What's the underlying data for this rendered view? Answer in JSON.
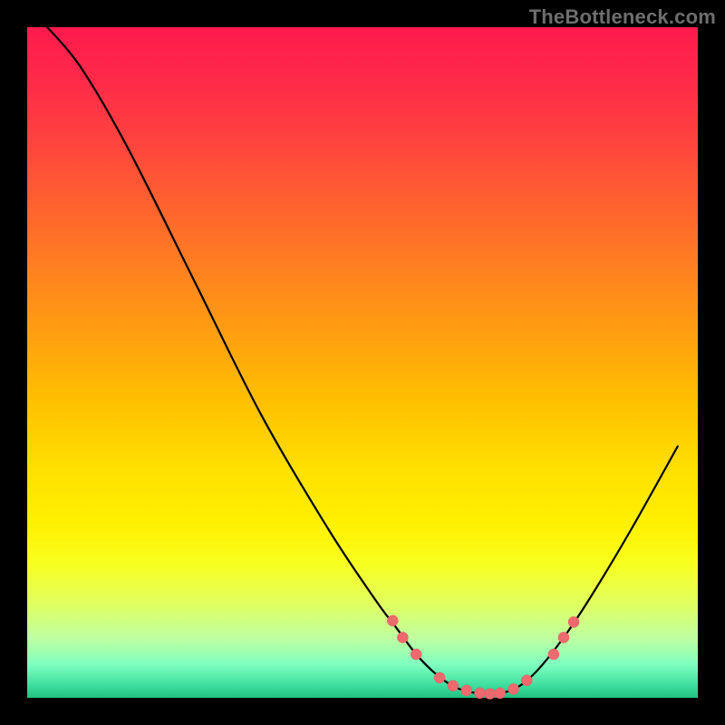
{
  "watermark": "TheBottleneck.com",
  "colors": {
    "frame": "#000000",
    "curve": "#000000",
    "marker_fill": "#ef6a6f",
    "marker_stroke": "#e85a60"
  },
  "chart_data": {
    "type": "line",
    "title": "",
    "xlabel": "",
    "ylabel": "",
    "xlim": [
      0,
      100
    ],
    "ylim": [
      0,
      100
    ],
    "grid": false,
    "curve_points": [
      {
        "x": 3.0,
        "y": 100.0
      },
      {
        "x": 8.0,
        "y": 94.0
      },
      {
        "x": 15.0,
        "y": 82.0
      },
      {
        "x": 25.0,
        "y": 62.0
      },
      {
        "x": 35.0,
        "y": 42.0
      },
      {
        "x": 45.0,
        "y": 25.0
      },
      {
        "x": 52.0,
        "y": 14.5
      },
      {
        "x": 55.0,
        "y": 10.5
      },
      {
        "x": 58.0,
        "y": 6.5
      },
      {
        "x": 61.0,
        "y": 3.5
      },
      {
        "x": 64.0,
        "y": 1.5
      },
      {
        "x": 67.0,
        "y": 0.7
      },
      {
        "x": 70.0,
        "y": 0.6
      },
      {
        "x": 73.0,
        "y": 1.5
      },
      {
        "x": 76.0,
        "y": 4.0
      },
      {
        "x": 80.0,
        "y": 9.0
      },
      {
        "x": 84.0,
        "y": 15.0
      },
      {
        "x": 90.0,
        "y": 25.0
      },
      {
        "x": 97.0,
        "y": 37.5
      }
    ],
    "markers": [
      {
        "x": 54.5,
        "y": 11.5
      },
      {
        "x": 56.0,
        "y": 9.0
      },
      {
        "x": 58.0,
        "y": 6.5
      },
      {
        "x": 61.5,
        "y": 3.0
      },
      {
        "x": 63.5,
        "y": 1.8
      },
      {
        "x": 65.5,
        "y": 1.1
      },
      {
        "x": 67.5,
        "y": 0.7
      },
      {
        "x": 69.0,
        "y": 0.6
      },
      {
        "x": 70.5,
        "y": 0.7
      },
      {
        "x": 72.5,
        "y": 1.3
      },
      {
        "x": 74.5,
        "y": 2.6
      },
      {
        "x": 78.5,
        "y": 6.5
      },
      {
        "x": 80.0,
        "y": 9.0
      },
      {
        "x": 81.5,
        "y": 11.3
      }
    ],
    "marker_radius_px": 6
  }
}
